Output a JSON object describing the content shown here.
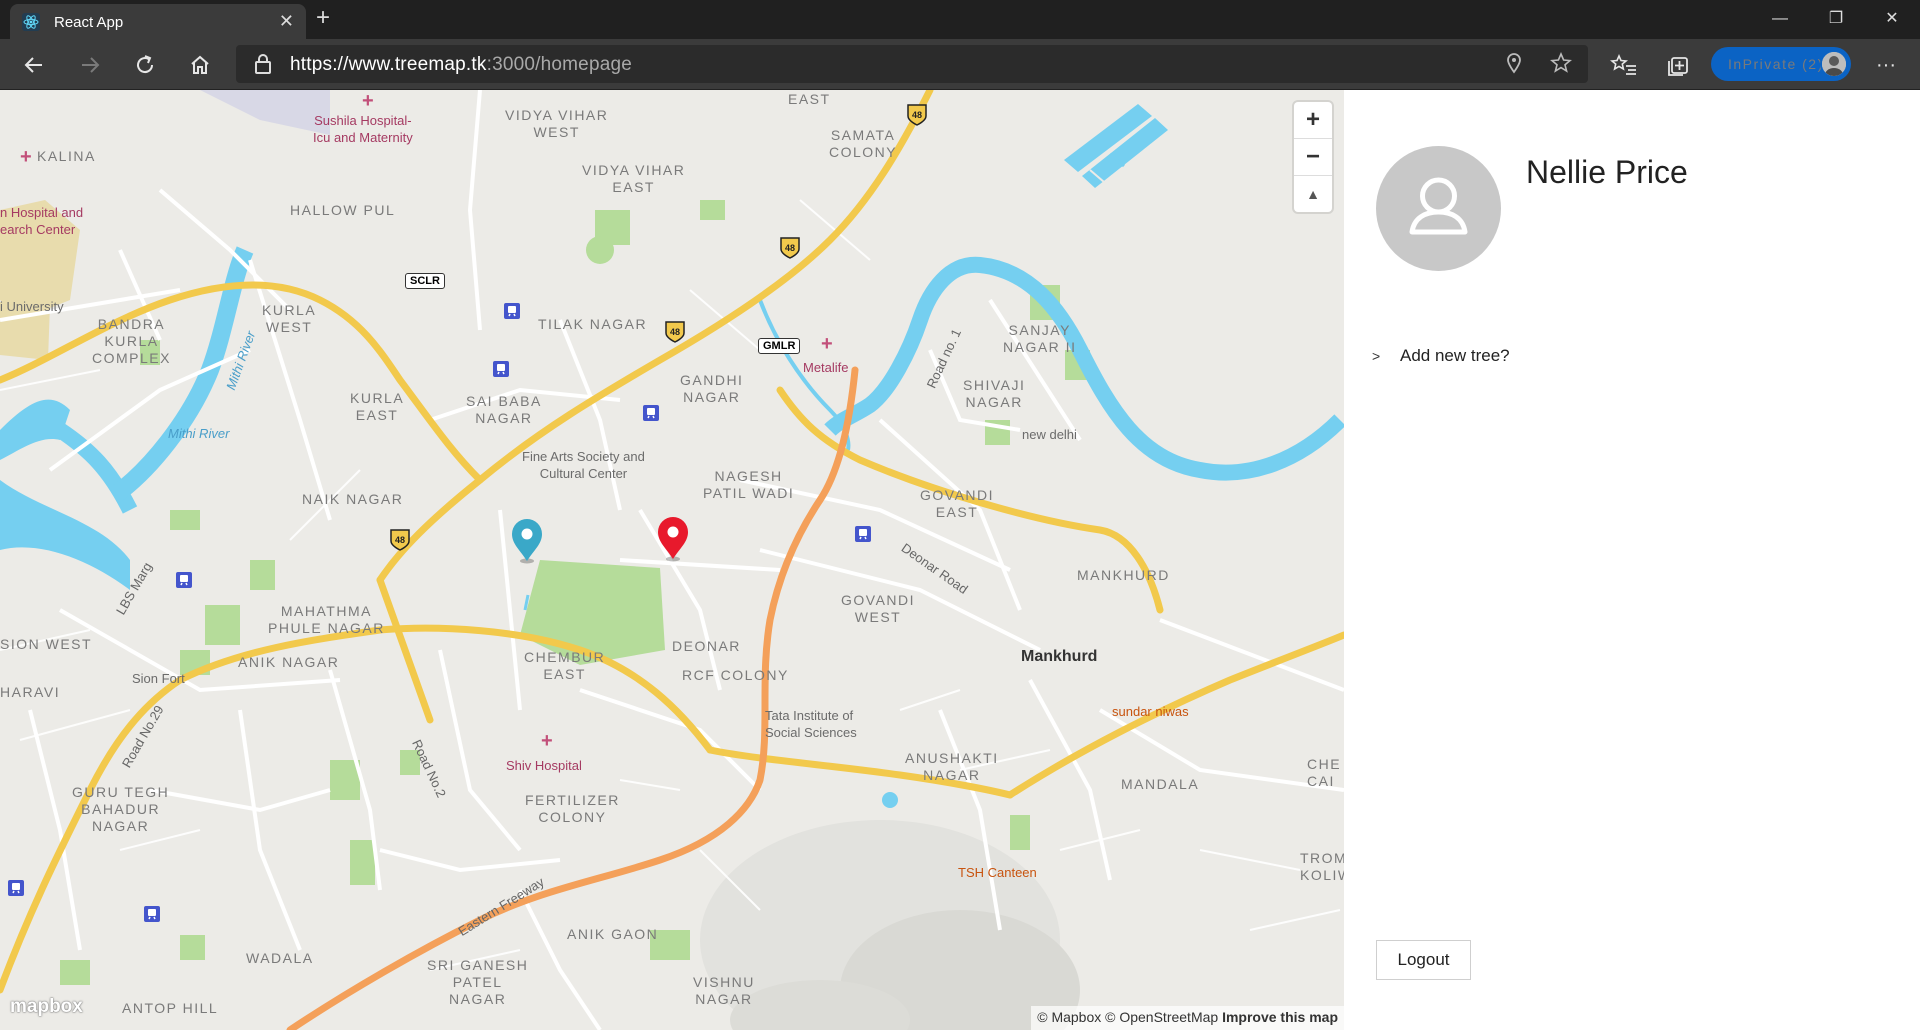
{
  "browser": {
    "tab_title": "React App",
    "tab_close": "✕",
    "new_tab": "+",
    "url_host": "https://www.treemap.tk",
    "url_path": ":3000/homepage",
    "inprivate_label": "InPrivate (2)",
    "window": {
      "minimize": "—",
      "restore": "❐",
      "close": "✕"
    },
    "more_label": "···"
  },
  "map": {
    "labels": {
      "east": "EAST",
      "vidya_vihar_west": "VIDYA VIHAR\nWEST",
      "samata_colony": "SAMATA\nCOLONY",
      "sushila_hospital": "Sushila Hospital-\nIcu and Maternity",
      "kalina": "KALINA",
      "hospital_research": "n Hospital and\nearch Center",
      "vidya_vihar_east": "VIDYA VIHAR\nEAST",
      "hallow_pul": "HALLOW PUL",
      "university": "i University",
      "kurla_west": "KURLA\nWEST",
      "bandra_kurla_complex": "BANDRA\nKURLA\nCOMPLEX",
      "tilak_nagar": "TILAK NAGAR",
      "sanjay_nagar": "SANJAY\nNAGAR II",
      "metalife": "Metalife",
      "road_no_1": "Road no. 1",
      "gandhi_nagar": "GANDHI\nNAGAR",
      "shivaji_nagar": "SHIVAJI\nNAGAR",
      "kurla_east": "KURLA\nEAST",
      "sai_baba_nagar": "SAI BABA\nNAGAR",
      "new_delhi": "new delhi",
      "mithi_river_1": "Mithi River",
      "mithi_river_2": "Mithi River",
      "fine_arts": "Fine Arts Society and\nCultural Center",
      "nagesh_patil_wadi": "NAGESH\nPATIL WADI",
      "govandi_east": "GOVANDI\nEAST",
      "naik_nagar": "NAIK NAGAR",
      "deonar_road": "Deonar Road",
      "mankhurd_area": "MANKHURD",
      "lbs_marg": "LBS Marg",
      "mahathma_phule": "MAHATHMA\nPHULE NAGAR",
      "govandi_west": "GOVANDI\nWEST",
      "sion_west": "SION WEST",
      "anik_nagar": "ANIK NAGAR",
      "chembur_east": "CHEMBUR\nEAST",
      "deonar": "DEONAR",
      "rcf_colony": "RCF COLONY",
      "mankhurd": "Mankhurd",
      "dharavi": "HARAVI",
      "sion_fort": "Sion Fort",
      "tata_institute": "Tata Institute of\nSocial Sciences",
      "sundar_niwas": "sundar niwas",
      "road_no_29": "Road No.29",
      "road_no_2": "Road No.2",
      "shiv_hospital": "Shiv Hospital",
      "anushakti_nagar": "ANUSHAKTI\nNAGAR",
      "mandala": "MANDALA",
      "che": "CHE\nCAI",
      "guru_tegh": "GURU TEGH\nBAHADUR\nNAGAR",
      "fertilizer_colony": "FERTILIZER\nCOLONY",
      "trom": "TROM\nKOLIW",
      "tsh_canteen": "TSH Canteen",
      "eastern_freeway": "Eastern Freeway",
      "anik_gaon": "ANIK GAON",
      "wadala": "WADALA",
      "sri_ganesh": "SRI GANESH\nPATEL\nNAGAR",
      "vishnu_nagar": "VISHNU\nNAGAR",
      "antop_hill": "ANTOP HILL",
      "sclr": "SCLR",
      "gmlr": "GMLR",
      "nh48": "48"
    },
    "zoom_in": "+",
    "zoom_out": "−",
    "compass": "▲",
    "logo": "mapbox",
    "attribution_1": "© Mapbox © OpenStreetMap",
    "attribution_2": "Improve this map",
    "colors": {
      "water": "#75cff0",
      "major_road": "#f2c94c",
      "freeway": "#f4a05a",
      "park": "#b5dc9a",
      "marker_blue": "#3aa8c8",
      "marker_red": "#e8192c"
    }
  },
  "panel": {
    "user_name": "Nellie Price",
    "add_tree_label": "Add new tree?",
    "add_tree_chevron": ">",
    "logout_label": "Logout"
  }
}
